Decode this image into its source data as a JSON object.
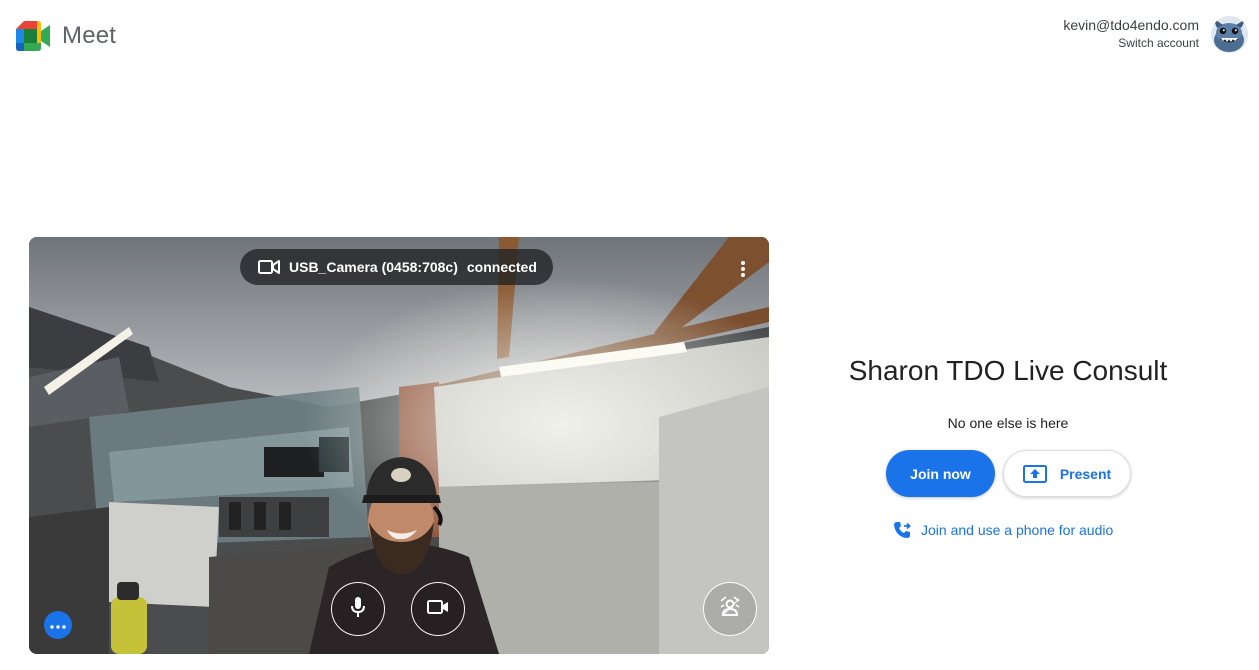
{
  "header": {
    "app_name": "Meet",
    "account_email": "kevin@tdo4endo.com",
    "switch_account": "Switch account"
  },
  "preview": {
    "camera_name": "USB_Camera (0458:708c)",
    "camera_status": "connected",
    "icons": {
      "camera_status": "videocam-icon",
      "more": "more-vert-icon",
      "mic": "mic-icon",
      "camera": "videocam-icon",
      "effects": "visual-effects-icon",
      "options": "more-horiz-icon"
    }
  },
  "meeting": {
    "title": "Sharon TDO Live Consult",
    "status": "No one else is here",
    "join_label": "Join now",
    "present_label": "Present",
    "phone_label": "Join and use a phone for audio"
  },
  "colors": {
    "accent": "#1a73e8",
    "text": "#202124",
    "secondary_text": "#5f6368"
  }
}
